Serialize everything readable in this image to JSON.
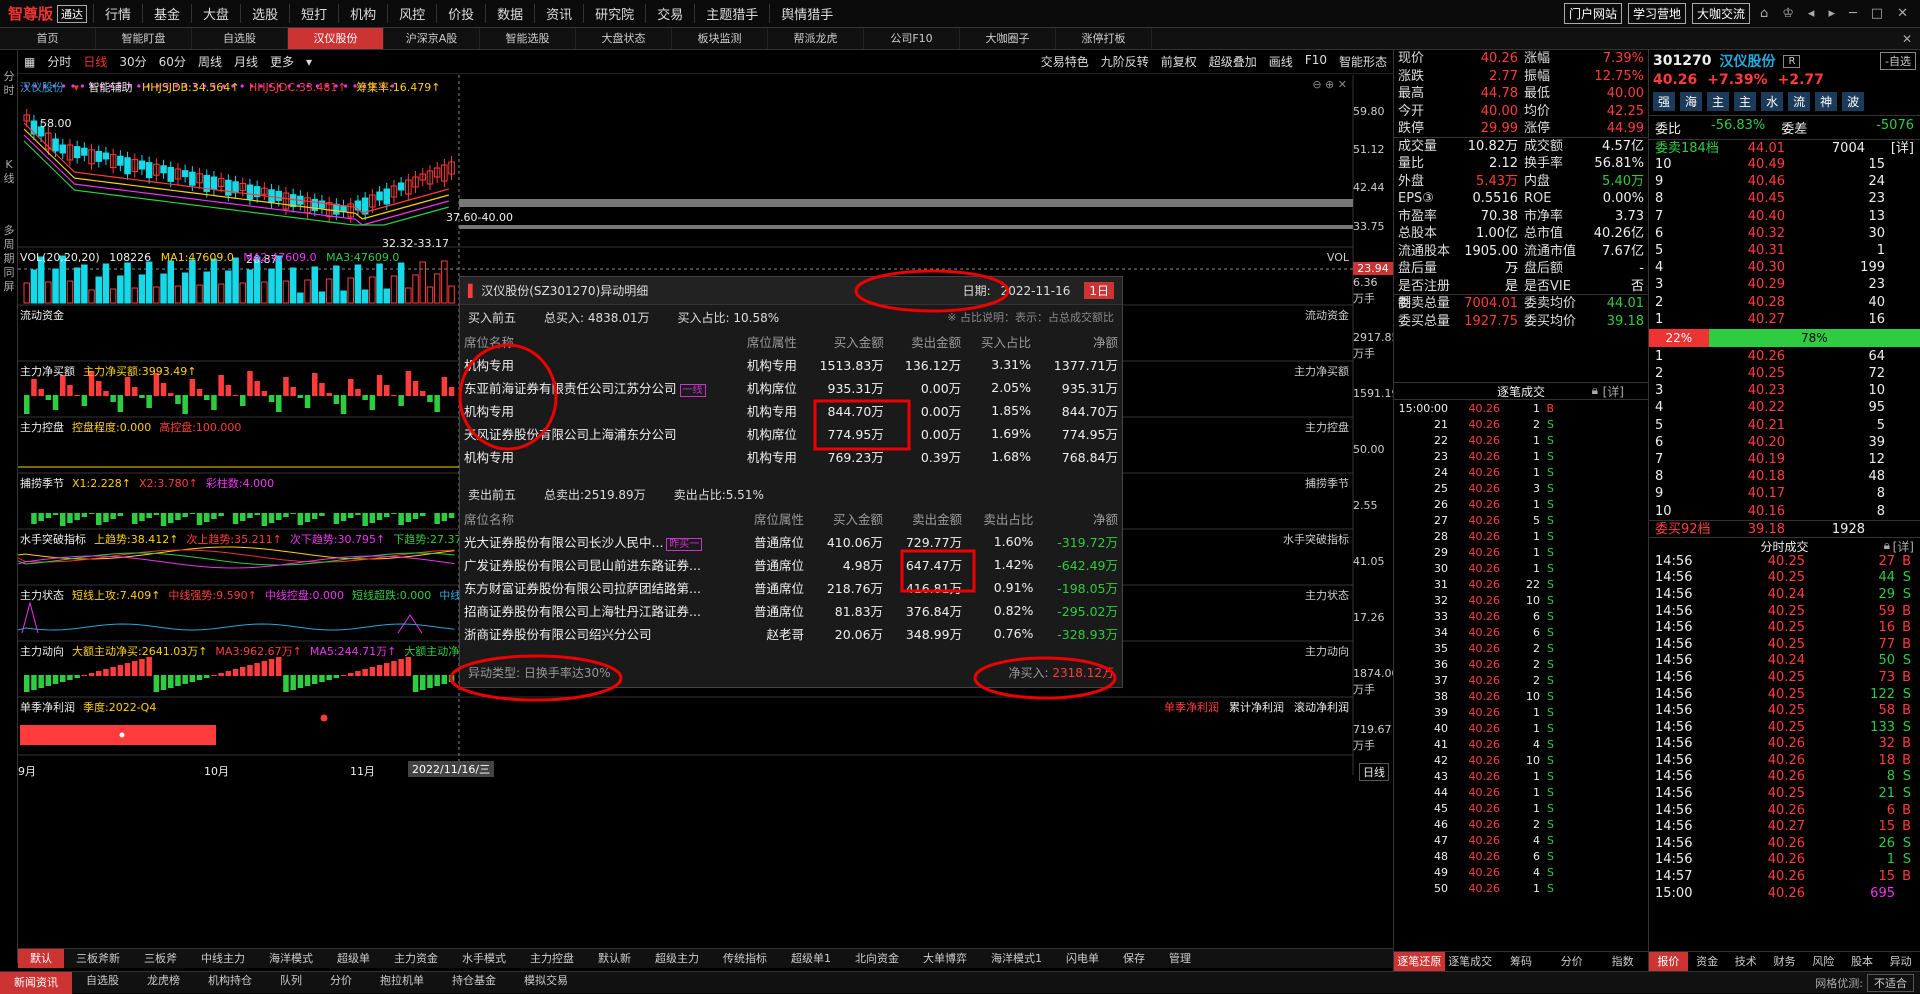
{
  "app": {
    "name": "智尊版",
    "badge": "通达"
  },
  "menu": [
    "行情",
    "基金",
    "大盘",
    "选股",
    "短打",
    "机构",
    "风控",
    "价投",
    "数据",
    "资讯",
    "研究院",
    "交易",
    "主题猎手",
    "舆情猎手"
  ],
  "top_buttons": [
    "门户网站",
    "学习营地",
    "大咖交流"
  ],
  "tabs": [
    {
      "label": "首页",
      "active": false
    },
    {
      "label": "智能盯盘",
      "active": false
    },
    {
      "label": "自选股",
      "active": false
    },
    {
      "label": "汉仪股份",
      "active": true
    },
    {
      "label": "沪深京A股",
      "active": false
    },
    {
      "label": "智能选股",
      "active": false
    },
    {
      "label": "大盘状态",
      "active": false
    },
    {
      "label": "板块监测",
      "active": false
    },
    {
      "label": "帮派龙虎",
      "active": false
    },
    {
      "label": "公司F10",
      "active": false
    },
    {
      "label": "大咖圈子",
      "active": false
    },
    {
      "label": "涨停打板",
      "active": false
    }
  ],
  "sidebar": [
    "分",
    "时",
    "K",
    "线",
    "多",
    "周",
    "期",
    "同",
    "屏"
  ],
  "toolbar": {
    "periods": [
      "分时",
      "日线",
      "30分",
      "60分",
      "周线",
      "月线",
      "更多"
    ],
    "active_period": "日线",
    "right_items": [
      "交易特色",
      "九阶反转",
      "前复权",
      "超级叠加",
      "画线",
      "F10",
      "智能形态"
    ]
  },
  "chart": {
    "header": {
      "name": "汉仪股份",
      "f1": "智能辅助",
      "f2": "HHJSJDB:34.564↑",
      "f3": "HHJSJDC:33.481↑",
      "f4": "筹集率:16.479↑"
    },
    "price_high": "58.00",
    "price_low": "26.87",
    "range_label": "37.60-40.00",
    "mid_label": "32.32-33.17",
    "y_labels": [
      "59.80",
      "51.12",
      "42.44",
      "33.75"
    ],
    "cursor_price": "23.94",
    "vol": {
      "title": "VOL(20,20,20)",
      "v": "108226",
      "ma1": "MA1:47609.0",
      "ma2": "MA2:47609.0",
      "ma3": "MA3:47609.0",
      "right": "VOL",
      "y1": "6.36",
      "u1": "万手"
    },
    "panels": [
      {
        "title": "流动资金",
        "right": "流动资金",
        "ylabel": "2917.85",
        "unit": "万手"
      },
      {
        "title": "主力净买额",
        "sub": "主力净买额:3993.49↑",
        "right": "主力净买额",
        "ylabel": "1591.19"
      },
      {
        "title": "主力控盘",
        "sub": "控盘程度:0.000",
        "sub2": "高控盘:100.000",
        "right": "主力控盘",
        "ylabel": "50.00"
      },
      {
        "title": "捕捞季节",
        "sub": "X1:2.228↑",
        "sub2": "X2:3.780↑",
        "sub3": "彩柱数:4.000",
        "right": "捕捞季节",
        "ylabel": "2.55"
      },
      {
        "title": "水手突破指标",
        "sub": "上趋势:38.412↑",
        "sub2": "次上趋势:35.211↑",
        "sub3": "次下趋势:30.795↑",
        "sub4": "下趋势:27.373",
        "right": "水手突破指标",
        "ylabel": "41.05"
      },
      {
        "title": "主力状态",
        "sub": "短线上攻:7.409↑",
        "sub2": "中线强势:9.590↑",
        "sub3": "中线控盘:0.000",
        "sub4": "短线超跌:0.000",
        "sub5": "中线超跌:0.000",
        "right": "主力状态",
        "ylabel": "17.26"
      },
      {
        "title": "主力动向",
        "sub": "大额主动净买:2641.03万↑",
        "sub2": "MA3:962.67万↑",
        "sub3": "MA5:244.71万↑",
        "sub4": "大额主动净买占比:5.78%↑",
        "right": "主力动向",
        "ylabel": "1874.00",
        "unit": "万手"
      },
      {
        "title": "单季净利润",
        "sub": "季度:2022-Q4",
        "right1": "单季净利润",
        "right2": "累计净利润",
        "right3": "滚动净利润",
        "ylabel": "719.67",
        "unit": "万手"
      }
    ],
    "xaxis": {
      "labels": [
        "9月",
        "10月",
        "11月"
      ],
      "cursor": "2022/11/16/三",
      "period": "日线"
    }
  },
  "popup": {
    "title": "汉仪股份(SZ301270)异动明细",
    "date_label": "日期:",
    "date": "2022-11-16",
    "range": "1日",
    "buy": {
      "header": "买入前五",
      "total": "总买入: 4838.01万",
      "ratio": "买入占比: 10.58%",
      "note": "※ 占比说明：表示：占总成交额比",
      "columns": [
        "席位名称",
        "席位属性",
        "买入金额",
        "卖出金额",
        "买入占比",
        "净额"
      ],
      "rows": [
        [
          "机构专用",
          "机构专用",
          "1513.83万",
          "136.12万",
          "3.31%",
          "1377.71万"
        ],
        [
          "东亚前海证券有限责任公司江苏分公司",
          "机构席位",
          "935.31万",
          "0.00万",
          "2.05%",
          "935.31万"
        ],
        [
          "机构专用",
          "机构专用",
          "844.70万",
          "0.00万",
          "1.85%",
          "844.70万"
        ],
        [
          "天风证券股份有限公司上海浦东分公司",
          "机构席位",
          "774.95万",
          "0.00万",
          "1.69%",
          "774.95万"
        ],
        [
          "机构专用",
          "机构专用",
          "769.23万",
          "0.39万",
          "1.68%",
          "768.84万"
        ]
      ],
      "tag": "一线"
    },
    "sell": {
      "header": "卖出前五",
      "total": "总卖出:2519.89万",
      "ratio": "卖出占比:5.51%",
      "columns": [
        "席位名称",
        "席位属性",
        "买入金额",
        "卖出金额",
        "卖出占比",
        "净额"
      ],
      "rows": [
        [
          "光大证券股份有限公司长沙人民中...",
          "普通席位",
          "410.06万",
          "729.77万",
          "1.60%",
          "-319.72万"
        ],
        [
          "广发证券股份有限公司昆山前进东路证券...",
          "普通席位",
          "4.98万",
          "647.47万",
          "1.42%",
          "-642.49万"
        ],
        [
          "东方财富证券股份有限公司拉萨团结路第...",
          "普通席位",
          "218.76万",
          "416.81万",
          "0.91%",
          "-198.05万"
        ],
        [
          "招商证券股份有限公司上海牡丹江路证券...",
          "普通席位",
          "81.83万",
          "376.84万",
          "0.82%",
          "-295.02万"
        ],
        [
          "浙商证券股份有限公司绍兴分公司",
          "赵老哥",
          "20.06万",
          "348.99万",
          "0.76%",
          "-328.93万"
        ]
      ],
      "tag": "昨买一"
    },
    "footer_type": "异动类型: 日换手率达30%",
    "net_label": "净买入:",
    "net_value": "2318.12万"
  },
  "quote": {
    "rows": [
      [
        "现价",
        "40.26",
        "涨幅",
        "7.39%"
      ],
      [
        "涨跌",
        "2.77",
        "振幅",
        "12.75%"
      ],
      [
        "最高",
        "44.78",
        "最低",
        "40.00"
      ],
      [
        "今开",
        "40.00",
        "均价",
        "42.25"
      ],
      [
        "跌停",
        "29.99",
        "涨停",
        "44.99"
      ],
      [
        "成交量",
        "10.82万",
        "成交额",
        "4.57亿"
      ],
      [
        "量比",
        "2.12",
        "换手率",
        "56.81%"
      ],
      [
        "外盘",
        "5.43万",
        "内盘",
        "5.40万"
      ],
      [
        "EPS③",
        "0.5516",
        "ROE",
        "0.00%"
      ],
      [
        "市盈率",
        "70.38",
        "市净率",
        "3.73"
      ],
      [
        "总股本",
        "1.00亿",
        "总市值",
        "40.26亿"
      ],
      [
        "流通股本",
        "1905.00万",
        "流通市值",
        "7.67亿"
      ],
      [
        "盘后量",
        "-",
        "盘后额",
        "-"
      ],
      [
        "是否注册制",
        "是",
        "是否VIE",
        "否"
      ],
      [
        "委卖总量",
        "7004.01",
        "委卖均价",
        "44.01"
      ],
      [
        "委买总量",
        "1927.75",
        "委买均价",
        "39.18"
      ]
    ],
    "ticks_title": "逐笔成交",
    "ticks_lock": "[详]",
    "ticks": [
      [
        "15:00:00",
        "40.26",
        "1",
        "B"
      ],
      [
        "21",
        "40.26",
        "2",
        "S"
      ],
      [
        "22",
        "40.26",
        "1",
        "S"
      ],
      [
        "23",
        "40.26",
        "1",
        "S"
      ],
      [
        "24",
        "40.26",
        "1",
        "S"
      ],
      [
        "25",
        "40.26",
        "3",
        "S"
      ],
      [
        "26",
        "40.26",
        "1",
        "S"
      ],
      [
        "27",
        "40.26",
        "5",
        "S"
      ],
      [
        "28",
        "40.26",
        "1",
        "S"
      ],
      [
        "29",
        "40.26",
        "1",
        "S"
      ],
      [
        "30",
        "40.26",
        "1",
        "S"
      ],
      [
        "31",
        "40.26",
        "22",
        "S"
      ],
      [
        "32",
        "40.26",
        "10",
        "S"
      ],
      [
        "33",
        "40.26",
        "6",
        "S"
      ],
      [
        "34",
        "40.26",
        "6",
        "S"
      ],
      [
        "35",
        "40.26",
        "2",
        "S"
      ],
      [
        "36",
        "40.26",
        "2",
        "S"
      ],
      [
        "37",
        "40.26",
        "2",
        "S"
      ],
      [
        "38",
        "40.26",
        "10",
        "S"
      ],
      [
        "39",
        "40.26",
        "1",
        "S"
      ],
      [
        "40",
        "40.26",
        "1",
        "S"
      ],
      [
        "41",
        "40.26",
        "4",
        "S"
      ],
      [
        "42",
        "40.26",
        "10",
        "S"
      ],
      [
        "43",
        "40.26",
        "1",
        "S"
      ],
      [
        "44",
        "40.26",
        "1",
        "S"
      ],
      [
        "45",
        "40.26",
        "1",
        "S"
      ],
      [
        "46",
        "40.26",
        "2",
        "S"
      ],
      [
        "47",
        "40.26",
        "4",
        "S"
      ],
      [
        "48",
        "40.26",
        "6",
        "S"
      ],
      [
        "49",
        "40.26",
        "4",
        "S"
      ],
      [
        "50",
        "40.26",
        "1",
        "S"
      ]
    ],
    "tabs": [
      "逐笔还原",
      "逐笔成交",
      "筹码",
      "分价",
      "指数"
    ]
  },
  "stock": {
    "code": "301270",
    "name": "汉仪股份",
    "tag": "R",
    "self_btn": "-自选",
    "price": "40.26",
    "pct": "+7.39%",
    "chg": "+2.77",
    "icons": [
      "强",
      "海",
      "主",
      "主",
      "水",
      "流",
      "神",
      "波"
    ],
    "weibi_label": "委比",
    "weibi": "-56.83%",
    "weicha_label": "委差",
    "weicha": "-5076",
    "sell_hdr": "委卖184档",
    "sell_hdr_price": "44.01",
    "sell_hdr_vol": "7004",
    "detail": "[详]",
    "asks": [
      [
        "10",
        "40.49",
        "15"
      ],
      [
        "9",
        "40.46",
        "24"
      ],
      [
        "8",
        "40.45",
        "23"
      ],
      [
        "7",
        "40.40",
        "13"
      ],
      [
        "6",
        "40.32",
        "30"
      ],
      [
        "5",
        "40.31",
        "1"
      ],
      [
        "4",
        "40.30",
        "199"
      ],
      [
        "3",
        "40.29",
        "23"
      ],
      [
        "2",
        "40.28",
        "40"
      ],
      [
        "1",
        "40.27",
        "16"
      ]
    ],
    "bar_left": "22%",
    "bar_right": "78%",
    "bids": [
      [
        "1",
        "40.26",
        "64"
      ],
      [
        "2",
        "40.25",
        "72"
      ],
      [
        "3",
        "40.23",
        "10"
      ],
      [
        "4",
        "40.22",
        "95"
      ],
      [
        "5",
        "40.21",
        "5"
      ],
      [
        "6",
        "40.20",
        "39"
      ],
      [
        "7",
        "40.19",
        "12"
      ],
      [
        "8",
        "40.18",
        "48"
      ],
      [
        "9",
        "40.17",
        "8"
      ],
      [
        "10",
        "40.16",
        "8"
      ]
    ],
    "buy_hdr": "委买92档",
    "buy_hdr_price": "39.18",
    "buy_hdr_vol": "1928",
    "trades_title": "分时成交",
    "trades": [
      [
        "14:56",
        "40.25",
        "27",
        "B"
      ],
      [
        "14:56",
        "40.25",
        "44",
        "S"
      ],
      [
        "14:56",
        "40.24",
        "29",
        "S"
      ],
      [
        "14:56",
        "40.25",
        "59",
        "B"
      ],
      [
        "14:56",
        "40.25",
        "16",
        "B"
      ],
      [
        "14:56",
        "40.25",
        "77",
        "B"
      ],
      [
        "14:56",
        "40.24",
        "50",
        "S"
      ],
      [
        "14:56",
        "40.25",
        "73",
        "B"
      ],
      [
        "14:56",
        "40.25",
        "122",
        "S"
      ],
      [
        "14:56",
        "40.25",
        "58",
        "B"
      ],
      [
        "14:56",
        "40.25",
        "133",
        "S"
      ],
      [
        "14:56",
        "40.26",
        "32",
        "B"
      ],
      [
        "14:56",
        "40.26",
        "18",
        "B"
      ],
      [
        "14:56",
        "40.26",
        "8",
        "S"
      ],
      [
        "14:56",
        "40.25",
        "21",
        "S"
      ],
      [
        "14:56",
        "40.26",
        "6",
        "B"
      ],
      [
        "14:56",
        "40.27",
        "15",
        "B"
      ],
      [
        "14:56",
        "40.26",
        "26",
        "S"
      ],
      [
        "14:56",
        "40.26",
        "1",
        "S"
      ],
      [
        "14:57",
        "40.26",
        "15",
        "B"
      ],
      [
        "15:00",
        "40.26",
        "695",
        ""
      ]
    ],
    "tabs": [
      "报价",
      "资金",
      "技术",
      "财务",
      "风险",
      "股本",
      "异动"
    ]
  },
  "bottom_tabs": [
    "默认",
    "三板斧新",
    "三板斧",
    "中线主力",
    "海洋模式",
    "超级单",
    "主力资金",
    "水手模式",
    "主力控盘",
    "默认新",
    "超级主力",
    "传统指标",
    "超级单1",
    "北向资金",
    "大单博弈",
    "海洋模式1",
    "闪电单",
    "保存",
    "管理"
  ],
  "footer": [
    "新闻资讯",
    "自选股",
    "龙虎榜",
    "机构持仓",
    "队列",
    "分价",
    "抱拉机单",
    "持仓基金",
    "模拟交易"
  ],
  "footer_right": {
    "label": "网格优测:",
    "value": "不适合"
  },
  "colors": {
    "up": "#ff3b3b",
    "down": "#2ecc40",
    "active_tab": "#cc3333",
    "candle_down": "#17d9e8"
  }
}
